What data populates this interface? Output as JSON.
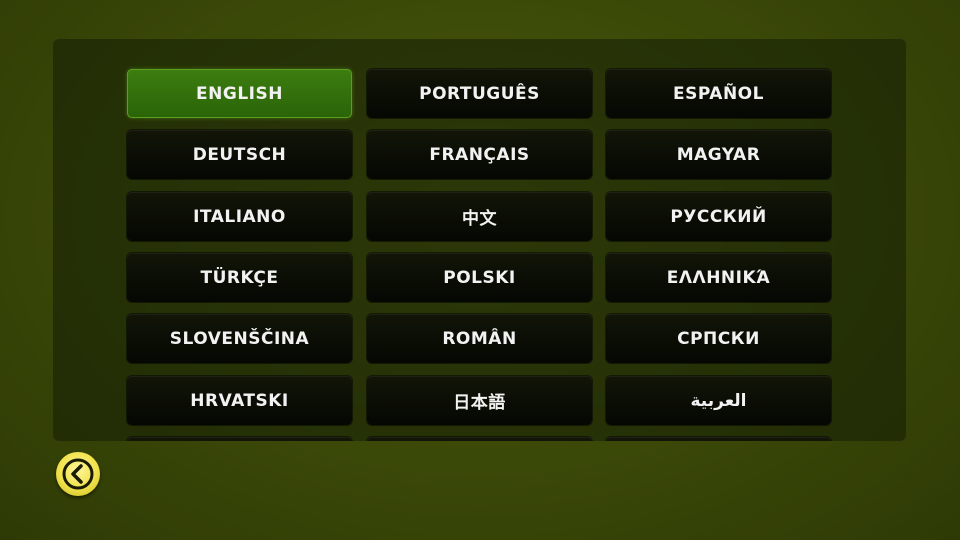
{
  "languages": [
    {
      "label": "ENGLISH",
      "selected": true
    },
    {
      "label": "PORTUGUÊS"
    },
    {
      "label": "ESPAÑOL"
    },
    {
      "label": "DEUTSCH"
    },
    {
      "label": "FRANÇAIS"
    },
    {
      "label": "MAGYAR"
    },
    {
      "label": "ITALIANO"
    },
    {
      "label": "中文"
    },
    {
      "label": "РУССКИЙ"
    },
    {
      "label": "TÜRKÇE"
    },
    {
      "label": "POLSKI"
    },
    {
      "label": "ΕΛΛΗΝΙΚΆ"
    },
    {
      "label": "SLOVENŠČINA"
    },
    {
      "label": "ROMÂN"
    },
    {
      "label": "СРПСКИ"
    },
    {
      "label": "HRVATSKI"
    },
    {
      "label": "日本語"
    },
    {
      "label": "العربية"
    }
  ],
  "colors": {
    "selected_button": "#2f6c0a",
    "button": "#0c0f05",
    "back_button": "#f0e24a"
  },
  "icons": {
    "back": "back-arrow-icon"
  }
}
